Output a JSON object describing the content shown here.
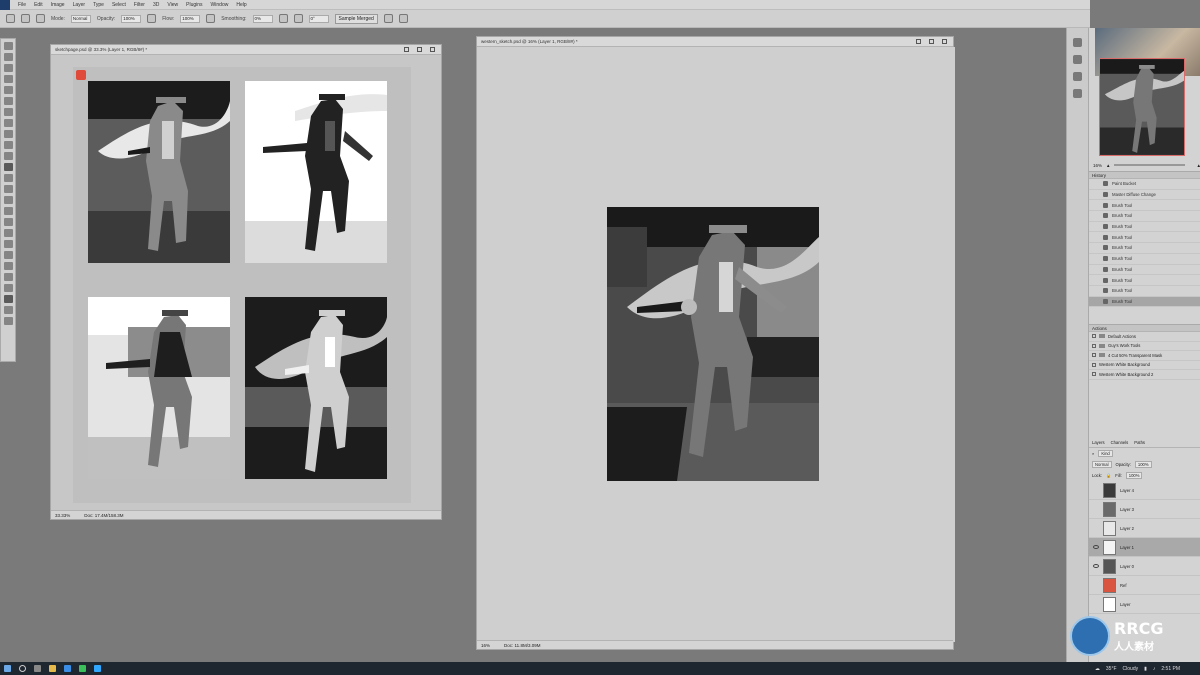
{
  "menubar": {
    "items": [
      "File",
      "Edit",
      "Image",
      "Layer",
      "Type",
      "Select",
      "Filter",
      "3D",
      "View",
      "Plugins",
      "Window",
      "Help"
    ]
  },
  "options": {
    "mode_label": "Mode:",
    "mode_value": "Normal",
    "opacity_label": "Opacity:",
    "opacity_value": "100%",
    "flow_label": "Flow:",
    "flow_value": "100%",
    "smoothing_label": "Smoothing:",
    "smoothing_value": "0%",
    "angle_value": "0°",
    "sample_label": "Sample Merged"
  },
  "doc1": {
    "title": "sketchpage.psd @ 33.3% (Layer 1, RGB/8#) *",
    "zoom": "33.33%",
    "doc_size": "Doc: 17.4M/158.3M"
  },
  "doc2": {
    "title": "western_sketch.psd @ 16% (Layer 1, RGB/8#) *",
    "zoom": "16%",
    "doc_size": "Doc: 11.8M/3.09M"
  },
  "navigator": {
    "zoom": "16%"
  },
  "history": {
    "title": "History",
    "items": [
      "Paint Bucket",
      "Master Diffuse Change",
      "Brush Tool",
      "Brush Tool",
      "Brush Tool",
      "Brush Tool",
      "Brush Tool",
      "Brush Tool",
      "Brush Tool",
      "Brush Tool",
      "Brush Tool",
      "Brush Tool",
      "Brush Tool"
    ]
  },
  "actions": {
    "title": "Actions",
    "items": [
      "Default Actions",
      "Guy's Work Tools",
      "4 Cut 50% Transparent Mask",
      "Western White Background",
      "Western White Background 2"
    ]
  },
  "layers": {
    "tabs": [
      "Layers",
      "Channels",
      "Paths"
    ],
    "kind": "Kind",
    "blend_mode": "Normal",
    "opacity_label": "Opacity:",
    "opacity_value": "100%",
    "lock_label": "Lock:",
    "fill_label": "Fill:",
    "fill_value": "100%",
    "items": [
      {
        "name": "Layer 4",
        "visible": false,
        "thumb": "#3a3a3a"
      },
      {
        "name": "Layer 3",
        "visible": false,
        "thumb": "#6a6a6a"
      },
      {
        "name": "Layer 2",
        "visible": false,
        "thumb": "#e8e8e8"
      },
      {
        "name": "Layer 1",
        "visible": true,
        "thumb": "#f4f4f4"
      },
      {
        "name": "Layer 0",
        "visible": true,
        "thumb": "#555555"
      },
      {
        "name": "Ref",
        "visible": false,
        "thumb": "#d9553f"
      },
      {
        "name": "Layer",
        "visible": false,
        "thumb": "#ffffff"
      }
    ]
  },
  "taskbar": {
    "temp": "35°F",
    "weather": "Cloudy",
    "time": "2:51 PM"
  },
  "logo": {
    "brand": "RRCG",
    "sub": "人人素材"
  }
}
